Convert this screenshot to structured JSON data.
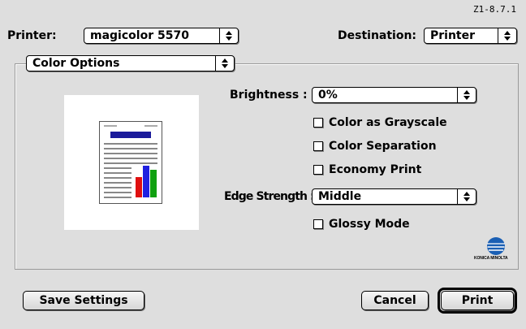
{
  "version": "Z1-8.7.1",
  "printer": {
    "label": "Printer:",
    "value": "magicolor 5570"
  },
  "destination": {
    "label": "Destination:",
    "value": "Printer"
  },
  "panel_selector": {
    "value": "Color Options"
  },
  "brightness": {
    "label": "Brightness :",
    "value": "0%"
  },
  "edge_strength": {
    "label": "Edge Strength :",
    "value": "Middle"
  },
  "checkboxes": {
    "color_as_grayscale": "Color as Grayscale",
    "color_separation": "Color Separation",
    "economy_print": "Economy Print",
    "glossy_mode": "Glossy Mode"
  },
  "buttons": {
    "save_settings": "Save Settings",
    "cancel": "Cancel",
    "print": "Print"
  },
  "logo": {
    "text": "KONICA MINOLTA",
    "icon": "konica-minolta-globe-icon"
  },
  "colors": {
    "window_bg": "#dedede",
    "doc_title_bar": "#1a1a9a",
    "bar_red": "#e01010",
    "bar_blue": "#2020e0",
    "bar_green": "#10a010",
    "logo_blue": "#1a5fb4"
  }
}
